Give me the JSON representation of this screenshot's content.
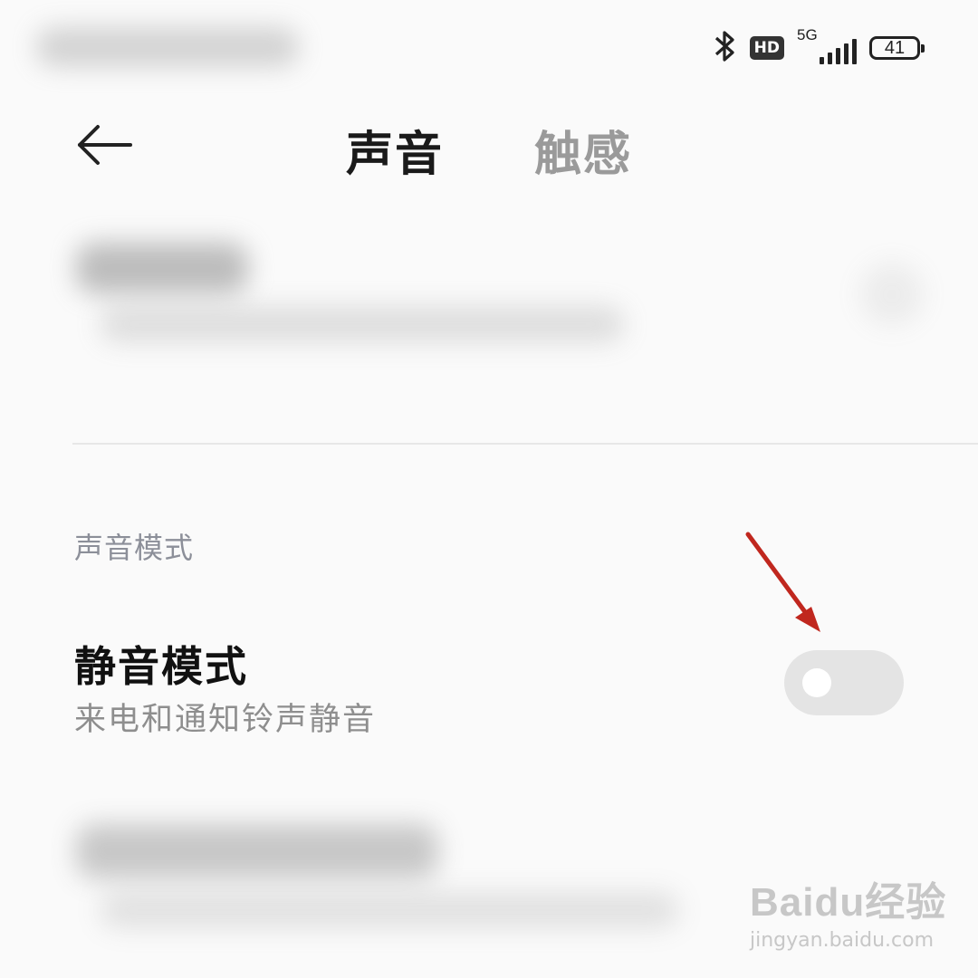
{
  "status_bar": {
    "hd_label": "HD",
    "network_label": "5G",
    "battery_level": "41"
  },
  "header": {
    "tabs": [
      {
        "label": "声音",
        "active": true
      },
      {
        "label": "触感",
        "active": false
      }
    ]
  },
  "section": {
    "title": "声音模式"
  },
  "silent_mode": {
    "title": "静音模式",
    "subtitle": "来电和通知铃声静音",
    "enabled": false
  },
  "watermark": {
    "brand": "Baidu经验",
    "url": "jingyan.baidu.com"
  },
  "colors": {
    "background": "#fafafa",
    "active_tab": "#1a1a1a",
    "inactive_tab": "#9a9a9a",
    "section_title": "#8c8f99",
    "toggle_off": "#e4e4e4",
    "annotation_arrow": "#c0271e"
  },
  "icons": [
    "bluetooth-icon",
    "hd-voice-icon",
    "signal-icon",
    "battery-icon",
    "back-arrow-icon",
    "annotation-arrow-icon"
  ]
}
